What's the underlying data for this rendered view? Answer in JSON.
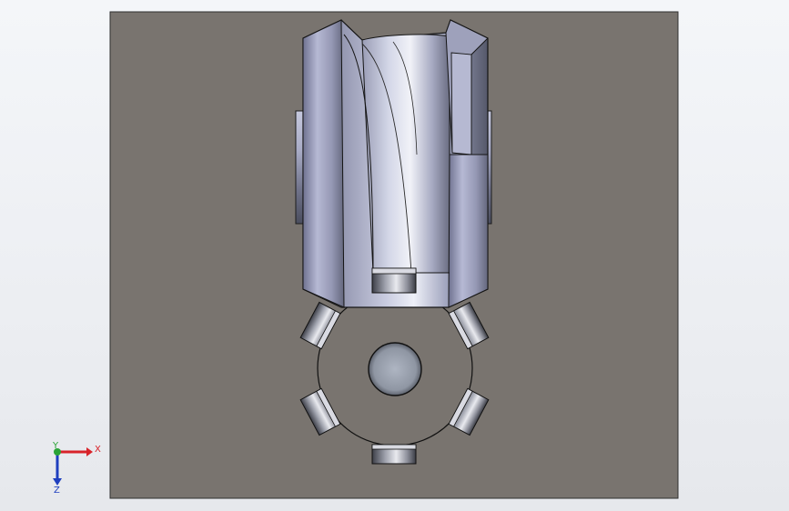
{
  "app": {
    "view": "cad-graphics-area"
  },
  "colors": {
    "viewport_bg": "#f1f3f6",
    "sheet_fill": "#79746f",
    "sheet_border": "#3a3a3a",
    "metal_light": "#e6e8f3",
    "metal_mid": "#a0a3bd",
    "metal_dark": "#585b6c",
    "triad_x": "#d8232a",
    "triad_y": "#2aa336",
    "triad_z": "#1f3fbf"
  },
  "triad": {
    "x_label": "X",
    "y_label": "Y",
    "z_label": "Z"
  },
  "model": {
    "parts": [
      "wheel-housing",
      "central-ring",
      "roller-top",
      "roller-upper-left",
      "roller-upper-right",
      "roller-lower-left",
      "roller-lower-right",
      "roller-bottom",
      "center-hole"
    ]
  }
}
